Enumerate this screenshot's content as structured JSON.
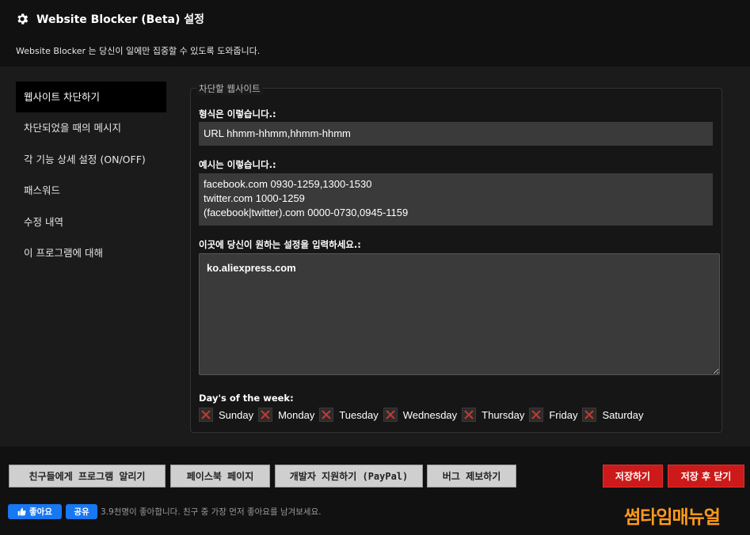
{
  "header": {
    "icon": "gear-icon",
    "title": "Website Blocker (Beta) 설정",
    "subtitle": "Website Blocker 는 당신이 일에만 집중할 수 있도록 도와줍니다."
  },
  "sidebar": {
    "items": [
      {
        "label": "웹사이트 차단하기",
        "active": true
      },
      {
        "label": "차단되었을 때의 메시지"
      },
      {
        "label": "각 기능 상세 설정 (ON/OFF)"
      },
      {
        "label": "패스워드"
      },
      {
        "label": "수정 내역"
      },
      {
        "label": "이 프로그램에 대해"
      }
    ]
  },
  "panel": {
    "legend": "차단할 웹사이트",
    "format_label": "형식은 이렇습니다.:",
    "format_value": "URL hhmm-hhmm,hhmm-hhmm",
    "example_label": "예시는 이렇습니다.:",
    "example_lines": [
      "facebook.com 0930-1259,1300-1530",
      "twitter.com 1000-1259",
      "(facebook|twitter).com 0000-0730,0945-1159"
    ],
    "input_label": "이곳에 당신이 원하는 설정을 입력하세요.:",
    "input_value": "ko.aliexpress.com",
    "days_label": "Day's of the week:",
    "days": [
      {
        "label": "Sunday",
        "checked": false
      },
      {
        "label": "Monday",
        "checked": false
      },
      {
        "label": "Tuesday",
        "checked": false
      },
      {
        "label": "Wednesday",
        "checked": false
      },
      {
        "label": "Thursday",
        "checked": false
      },
      {
        "label": "Friday",
        "checked": false
      },
      {
        "label": "Saturday",
        "checked": false
      }
    ]
  },
  "footer": {
    "tell_friends": "친구들에게 프로그램 알리기",
    "facebook_page": "페이스북 페이지",
    "donate": "개발자 지원하기 (PayPal)",
    "report_bug": "버그 제보하기",
    "save": "저장하기",
    "save_close": "저장 후 닫기",
    "fb_like": "좋아요",
    "fb_share": "공유",
    "fb_text": "3.9천명이 좋아합니다. 친구 중 가장 먼저 좋아요를 남겨보세요.",
    "watermark": "썸타임매뉴얼"
  },
  "colors": {
    "accent_red": "#cc1a1a",
    "facebook_blue": "#1877f2",
    "watermark_orange": "#ff9a1a"
  }
}
